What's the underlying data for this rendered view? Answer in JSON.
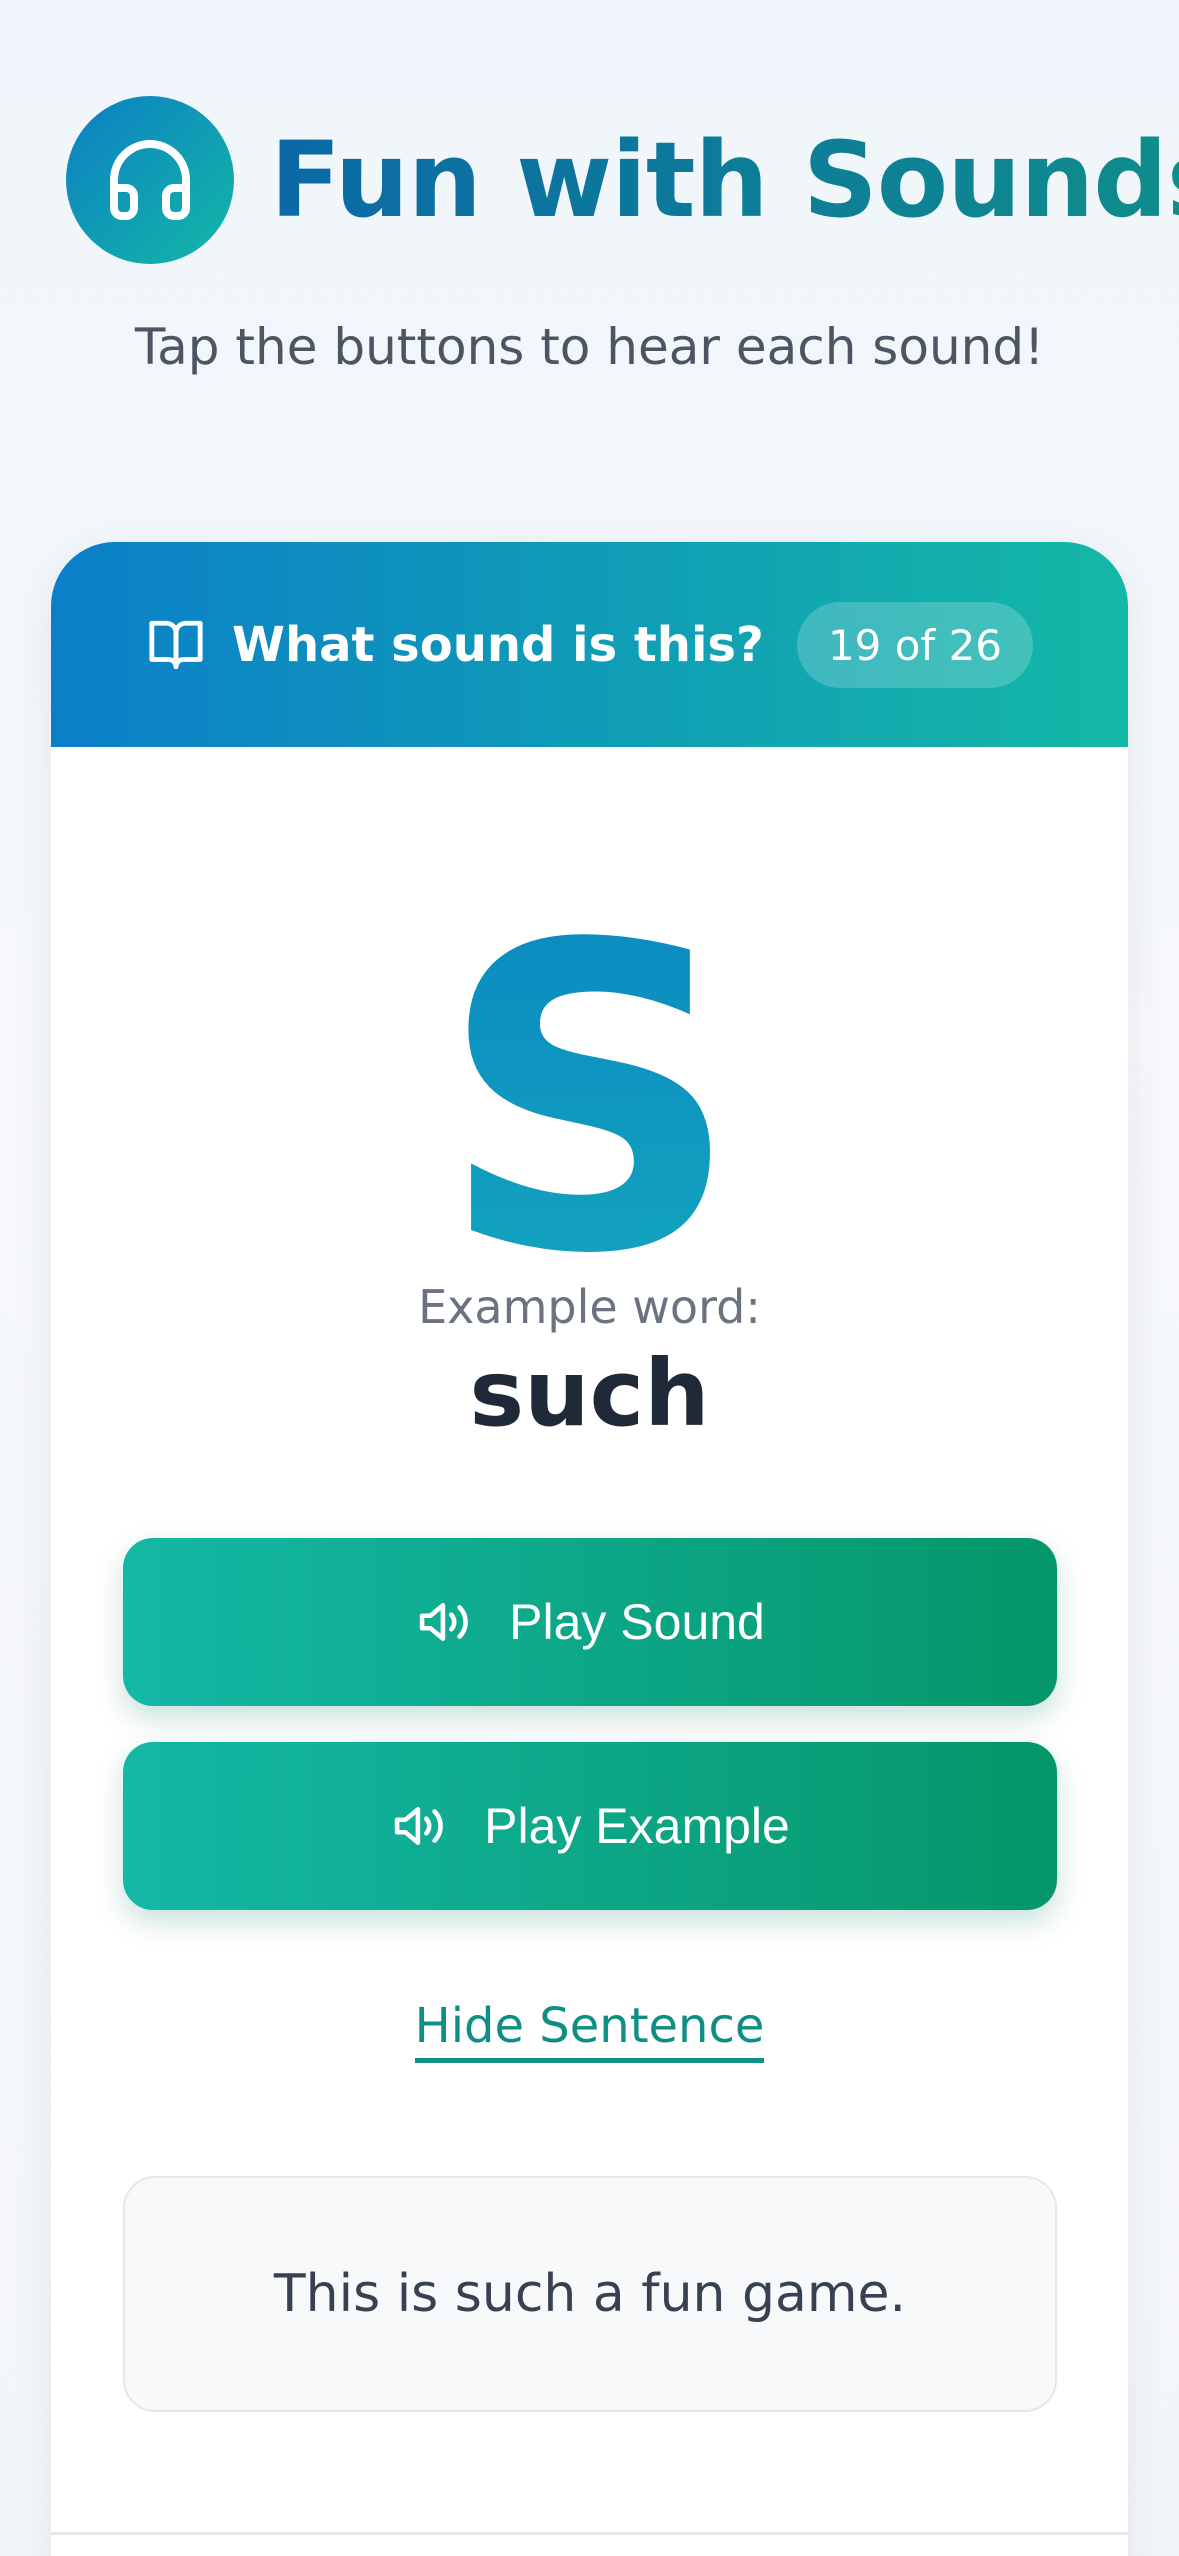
{
  "app": {
    "title": "Fun with Sounds",
    "subtitle": "Tap the buttons to hear each sound!",
    "logo_icon": "headphones-icon"
  },
  "card": {
    "title": "What sound is this?",
    "title_icon": "book-icon",
    "progress": "19 of 26",
    "letter": "S",
    "example_label": "Example word:",
    "example_word": "such",
    "play_sound_label": "Play Sound",
    "play_example_label": "Play Example",
    "speaker_icon": "speaker-icon",
    "hide_sentence_label": "Hide Sentence",
    "sentence": "This is such a fun game."
  },
  "colors": {
    "brand_blue": "#0b7fc8",
    "brand_teal": "#14b8a6",
    "button_green": "#059669",
    "link_teal": "#0f8f84"
  }
}
